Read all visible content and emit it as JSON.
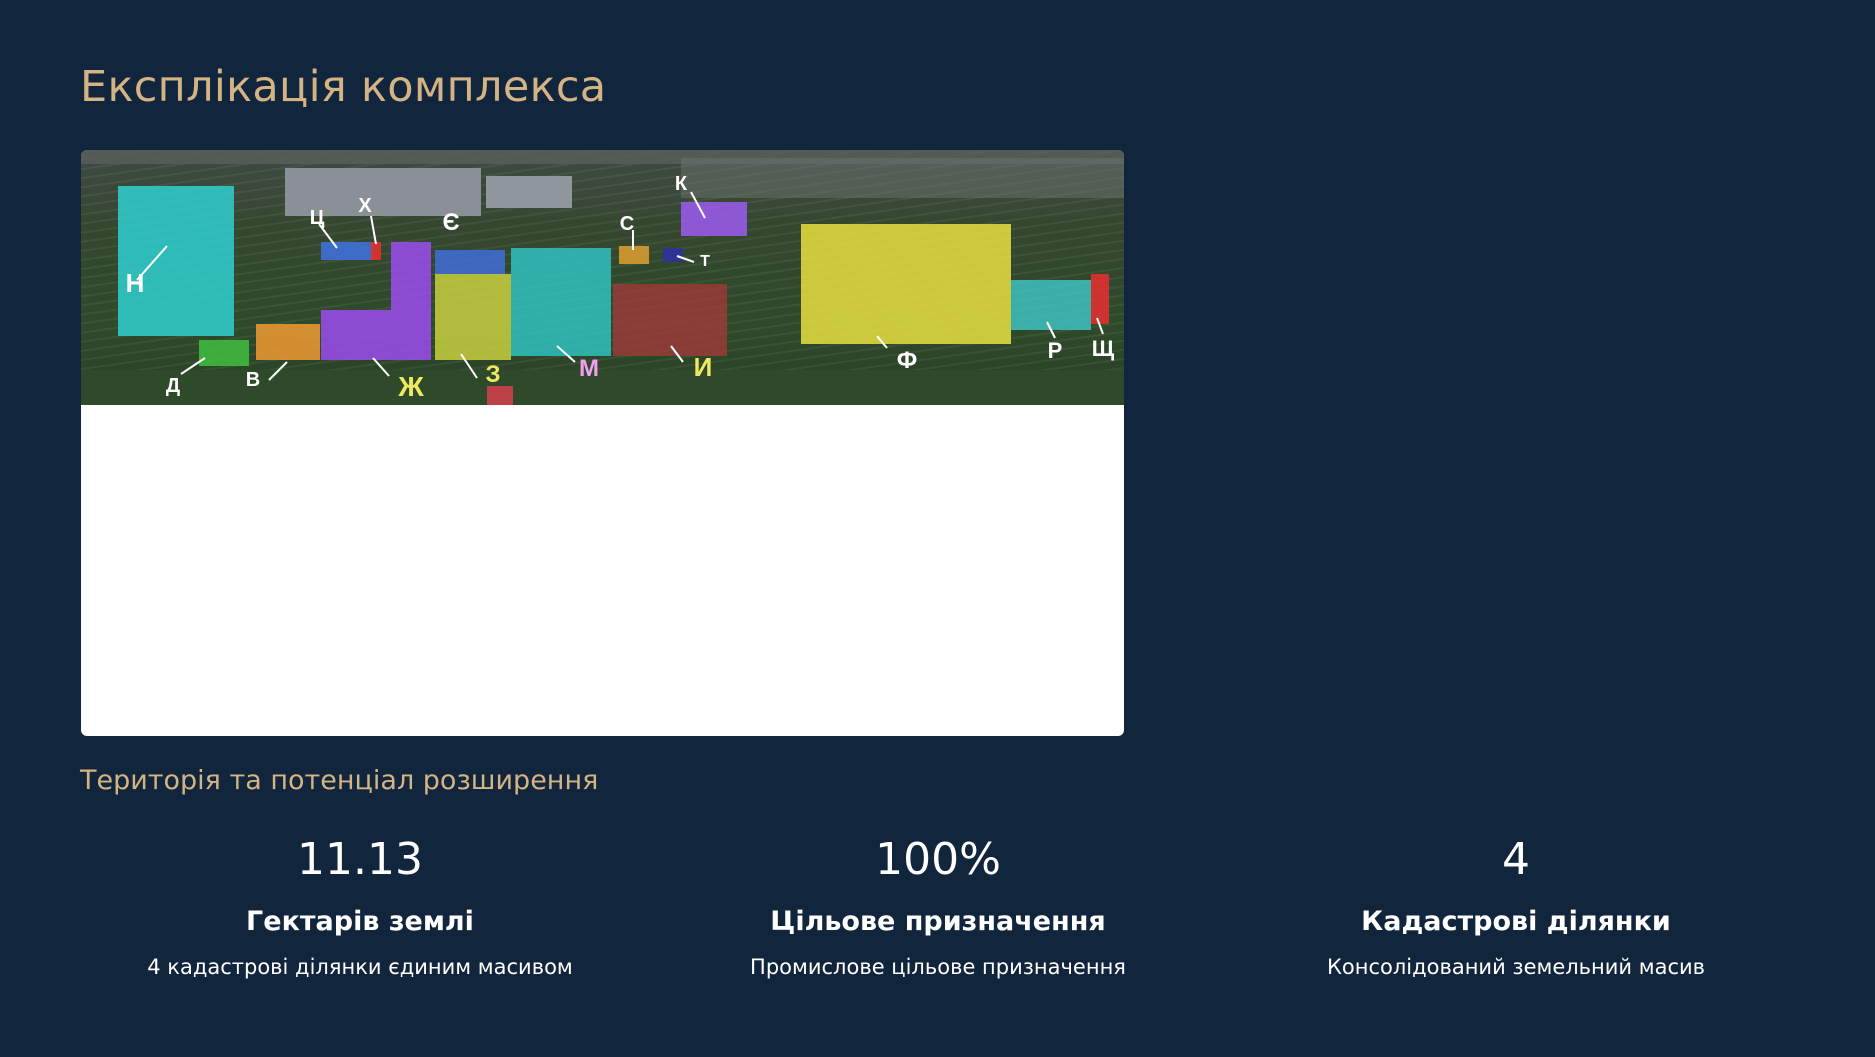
{
  "page": {
    "title": "Експлікація комплекса",
    "subtitle": "Територія та потенціал розширення"
  },
  "map": {
    "building_labels": [
      "Н",
      "Ц",
      "Х",
      "Є",
      "К",
      "С",
      "Т",
      "Д",
      "В",
      "Ж",
      "З",
      "М",
      "И",
      "Ф",
      "Р",
      "Щ"
    ]
  },
  "stats": [
    {
      "value": "11.13",
      "label": "Гектарів землі",
      "description": "4 кадастрові ділянки єдиним масивом"
    },
    {
      "value": "100%",
      "label": "Цільове призначення",
      "description": "Промислове цільове призначення"
    },
    {
      "value": "4",
      "label": "Кадастрові ділянки",
      "description": "Консолідований земельний масив"
    }
  ],
  "colors": {
    "background": "#11253c",
    "accent": "#d4b384"
  }
}
